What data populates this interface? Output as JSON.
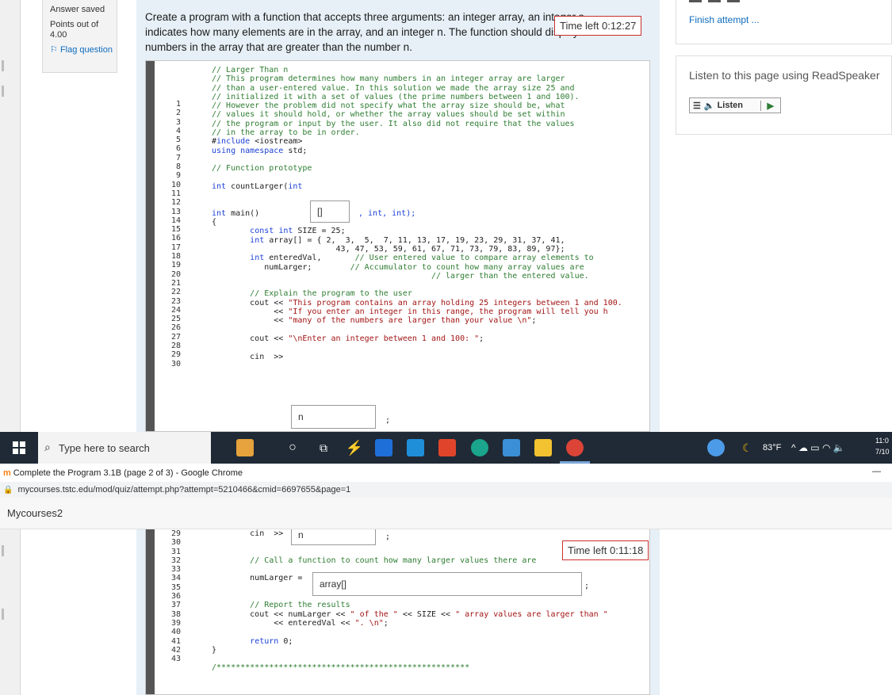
{
  "top": {
    "info": {
      "status": "Answer saved",
      "points": "Points out of 4.00",
      "flag": "Flag question"
    },
    "question_text": "Create a program with a function that accepts three arguments: an integer array, an integer s... indicates how many elements are in the array, and an integer n. The function should display a... numbers in the array that are greater than the number n.",
    "question_lines": [
      "Create a program with a function that accepts three arguments: an integer array, an integer s",
      "indicates how many elements are in the array, and an integer n. The function should display a",
      "numbers in the array that are greater than the number n."
    ],
    "timer": "Time left 0:12:27",
    "right": {
      "finish_link": "Finish attempt ...",
      "readspeaker_title": "Listen to this page using ReadSpeaker",
      "listen_label": "Listen"
    },
    "code_lines": [
      "// Larger Than n",
      "// This program determines how many numbers in an integer array are larger",
      "// than a user-entered value. In this solution we made the array size 25 and",
      "// initialized it with a set of values (the prime numbers between 1 and 100).",
      "// However the problem did not specify what the array size should be, what",
      "// values it should hold, or whether the array values should be set within",
      "// the program or input by the user. It also did not require that the values",
      "// in the array to be in order.",
      "#include <iostream>",
      "using namespace std;",
      "",
      "// Function prototype",
      "",
      "int countLarger(int",
      "",
      "",
      "int main()",
      "{",
      "        const int SIZE = 25;",
      "        int array[] = { 2,  3,  5,  7, 11, 13, 17, 19, 23, 29, 31, 37, 41,",
      "                          43, 47, 53, 59, 61, 67, 71, 73, 79, 83, 89, 97};",
      "        int enteredVal,       // User entered value to compare array elements to",
      "           numLarger;        // Accumulator to count how many array values are",
      "                                              // larger than the entered value.",
      "",
      "        // Explain the program to the user",
      "        cout << \"This program contains an array holding 25 integers between 1 and 100.",
      "             << \"If you enter an integer in this range, the program will tell you h",
      "             << \"many of the numbers are larger than your value \\n\";",
      "",
      "        cout << \"\\nEnter an integer between 1 and 100: \";",
      "",
      "        cin  >>"
    ],
    "line_numbers": [
      "1",
      "2",
      "3",
      "4",
      "5",
      "6",
      "7",
      "8",
      "9",
      "10",
      "11",
      "12",
      "13",
      "14",
      "15",
      "16",
      "17",
      "18",
      "19",
      "20",
      "21",
      "22",
      "23",
      "24",
      "25",
      "26",
      "27",
      "28",
      "29",
      "30"
    ],
    "prototype_rest": ", int, int);",
    "blank_array": "[]",
    "blank_cin": "n",
    "cin_semicolon": ";"
  },
  "taskbar": {
    "search_placeholder": "Type here to search",
    "weather": "83°F",
    "clock_time": "11:0",
    "clock_date": "7/10"
  },
  "chrome": {
    "title": "Complete the Program 3.1B (page 2 of 3) - Google Chrome",
    "minimize": "—",
    "url": "mycourses.tstc.edu/mod/quiz/attempt.php?attempt=5210466&cmid=6697655&page=1",
    "site_name": "Mycourses2",
    "timer": "Time left 0:11:18",
    "line_numbers": [
      "29",
      "30",
      "31",
      "32",
      "33",
      "34",
      "35",
      "36",
      "37",
      "38",
      "39",
      "40",
      "41",
      "42",
      "43"
    ],
    "code_lines": [
      "        cin  >>",
      "",
      "",
      "        // Call a function to count how many larger values there are",
      "",
      "        numLarger =",
      "",
      "",
      "        // Report the results",
      "        cout << numLarger << \" of the \" << SIZE << \" array values are larger than \"",
      "             << enteredVal << \". \\n\";",
      "",
      "        return 0;",
      "}",
      "",
      "/*****************************************************"
    ],
    "blank_cin": "n",
    "blank_call": "array[]",
    "semicolon": ";"
  }
}
